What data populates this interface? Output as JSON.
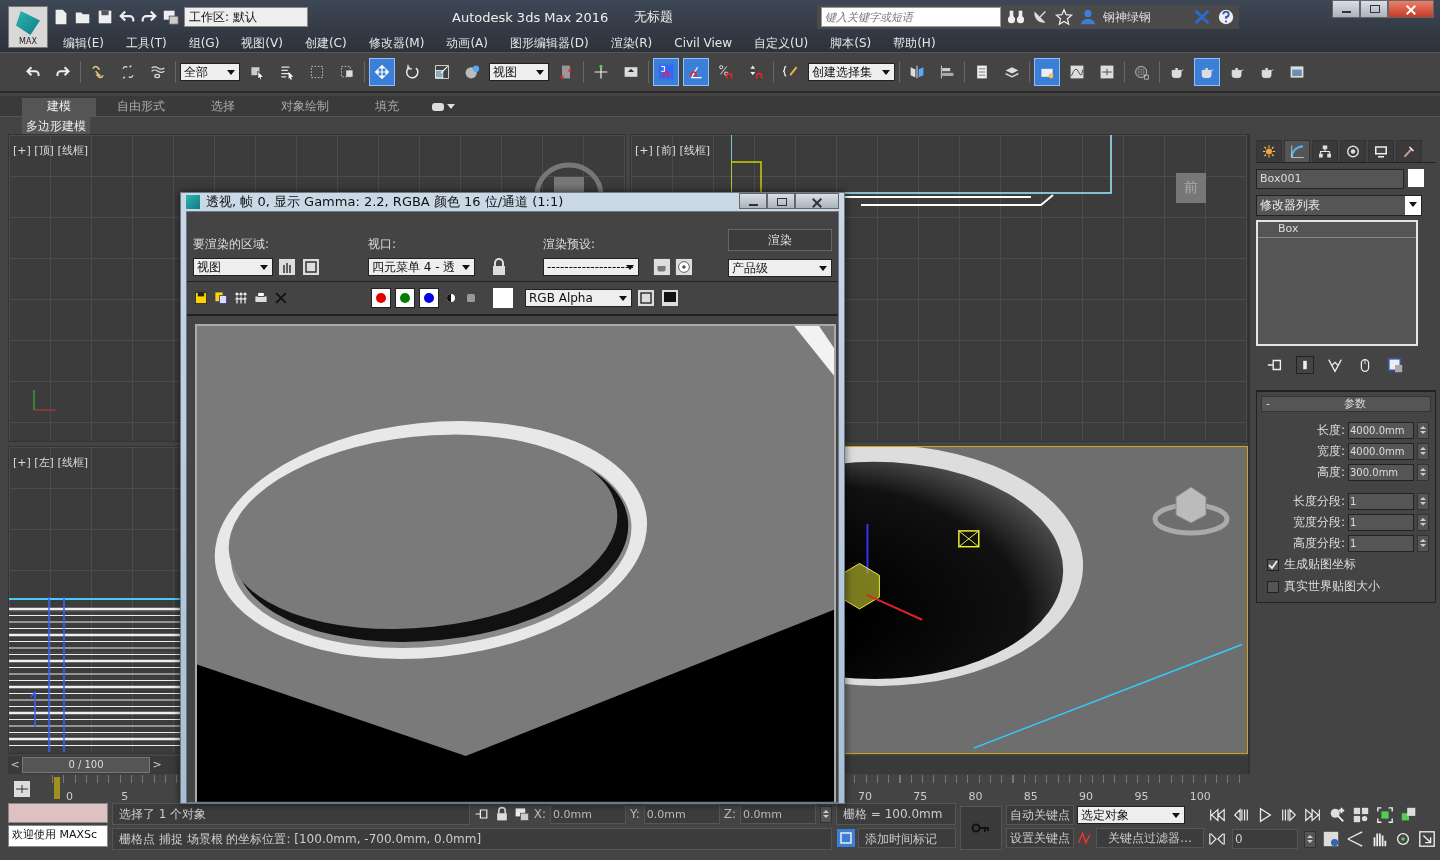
{
  "title_bar": {
    "logo": "MAX",
    "workspace": "工作区: 默认",
    "app_title": "Autodesk 3ds Max 2016",
    "document": "无标题",
    "search": {
      "placeholder": "键入关键字或短语"
    },
    "user": "钢神绿钢"
  },
  "menu": [
    "编辑(E)",
    "工具(T)",
    "组(G)",
    "视图(V)",
    "创建(C)",
    "修改器(M)",
    "动画(A)",
    "图形编辑器(D)",
    "渲染(R)",
    "Civil View",
    "自定义(U)",
    "脚本(S)",
    "帮助(H)"
  ],
  "toolbar": [
    {
      "kind": "undo",
      "selected": false
    },
    {
      "kind": "redo",
      "selected": false
    },
    {
      "kind": "sep"
    },
    {
      "kind": "link",
      "selected": false
    },
    {
      "kind": "unlink",
      "selected": false
    },
    {
      "kind": "wave",
      "selected": false
    },
    {
      "kind": "sep"
    },
    {
      "kind": "dropdown",
      "value": "全部"
    },
    {
      "kind": "select",
      "selected": false
    },
    {
      "kind": "select-list",
      "selected": false
    },
    {
      "kind": "rect-region",
      "selected": false
    },
    {
      "kind": "crossing",
      "selected": false
    },
    {
      "kind": "sep"
    },
    {
      "kind": "move",
      "selected": true
    },
    {
      "kind": "rotate",
      "selected": false
    },
    {
      "kind": "scale",
      "selected": false
    },
    {
      "kind": "sphere",
      "selected": false
    },
    {
      "kind": "dropdown",
      "value": "视图"
    },
    {
      "kind": "pivot",
      "selected": false
    },
    {
      "kind": "sep"
    },
    {
      "kind": "axis",
      "selected": false
    },
    {
      "kind": "tray",
      "selected": false
    },
    {
      "kind": "sep"
    },
    {
      "kind": "snap",
      "selected": true
    },
    {
      "kind": "angle-snap",
      "selected": true
    },
    {
      "kind": "percent-snap",
      "selected": false
    },
    {
      "kind": "spinner-snap",
      "selected": false
    },
    {
      "kind": "sep"
    },
    {
      "kind": "pencil",
      "selected": false
    },
    {
      "kind": "dropdown",
      "value": "创建选择集"
    },
    {
      "kind": "sep"
    },
    {
      "kind": "mirror",
      "selected": false
    },
    {
      "kind": "align",
      "selected": false
    },
    {
      "kind": "sep"
    },
    {
      "kind": "list",
      "selected": false
    },
    {
      "kind": "layers",
      "selected": false
    },
    {
      "kind": "sep"
    },
    {
      "kind": "folder",
      "selected": true
    },
    {
      "kind": "curve",
      "selected": false
    },
    {
      "kind": "schematic",
      "selected": false
    },
    {
      "kind": "sep"
    },
    {
      "kind": "checker-sphere",
      "selected": false
    },
    {
      "kind": "sep"
    },
    {
      "kind": "teapot",
      "selected": false
    },
    {
      "kind": "teapot",
      "selected": true
    },
    {
      "kind": "teapot",
      "selected": false
    },
    {
      "kind": "teapot",
      "selected": false
    },
    {
      "kind": "picture",
      "selected": false
    }
  ],
  "ribbon": {
    "tabs": [
      {
        "label": "建模",
        "selected": true
      },
      {
        "label": "自由形式",
        "selected": false
      },
      {
        "label": "选择",
        "selected": false
      },
      {
        "label": "对象绘制",
        "selected": false
      },
      {
        "label": "填充",
        "selected": false
      }
    ],
    "panel": "多边形建模"
  },
  "viewports": [
    {
      "kind": "top",
      "label": "[+] [顶] [线框]"
    },
    {
      "kind": "front",
      "label": "[+] [前] [线框]",
      "cube_label": "前"
    },
    {
      "kind": "left",
      "label": "[+] [左] [线框]"
    },
    {
      "kind": "perspective"
    }
  ],
  "time_slider": {
    "prev": "<",
    "position": "0 / 100",
    "next": ">"
  },
  "ruler": {
    "start_ticks": [
      "0",
      "5"
    ],
    "end_ticks": [
      "70",
      "75",
      "80",
      "85",
      "90",
      "95",
      "100"
    ]
  },
  "command_panel": {
    "tabs": [
      {
        "kind": "sun",
        "selected": false
      },
      {
        "kind": "arc",
        "selected": true
      },
      {
        "kind": "hierarchy",
        "selected": false
      },
      {
        "kind": "target",
        "selected": false
      },
      {
        "kind": "monitor",
        "selected": false
      },
      {
        "kind": "hammer",
        "selected": false
      }
    ],
    "object_name": "Box001",
    "modifier_list": "修改器列表",
    "stack": [
      "Box"
    ],
    "rollout": {
      "toggle": "-",
      "title": "参数"
    },
    "params": [
      {
        "label": "长度:",
        "value": "4000.0mm"
      },
      {
        "label": "宽度:",
        "value": "4000.0mm"
      },
      {
        "label": "高度:",
        "value": "300.0mm"
      }
    ],
    "segments": [
      {
        "label": "长度分段:",
        "value": "1"
      },
      {
        "label": "宽度分段:",
        "value": "1"
      },
      {
        "label": "高度分段:",
        "value": "1"
      }
    ],
    "options": [
      {
        "label": "生成贴图坐标",
        "checked": true
      },
      {
        "label": "真实世界贴图大小",
        "checked": false
      }
    ]
  },
  "render_window": {
    "title": "透视, 帧 0, 显示 Gamma: 2.2, RGBA 颜色 16 位/通道 (1:1)",
    "area_label": "要渲染的区域:",
    "area": "视图",
    "viewport_label": "视口:",
    "viewport": "四元菜单 4 - 透",
    "preset_label": "渲染预设:",
    "preset": "--------------------",
    "render_button": "渲染",
    "quality": "产品级",
    "channels": [
      {
        "color": "#e00000",
        "selected": true
      },
      {
        "color": "#008000",
        "selected": true
      },
      {
        "color": "#0000e0",
        "selected": true
      }
    ],
    "display": "RGB Alpha"
  },
  "status": {
    "maxscript": "欢迎使用 MAXSc",
    "selection": "选择了 1 个对象",
    "prompt": "栅格点 捕捉 场景根 的坐标位置:  [100.0mm, -700.0mm, 0.0mm]",
    "coords": [
      {
        "axis": "X:",
        "value": "0.0mm"
      },
      {
        "axis": "Y:",
        "value": "0.0mm"
      },
      {
        "axis": "Z:",
        "value": "0.0mm"
      }
    ],
    "grid": "栅格 = 100.0mm",
    "add_time_tag": "添加时间标记",
    "auto_key": "自动关键点",
    "set_key": "设置关键点",
    "key_mode": "选定对象",
    "key_filters": "关键点过滤器...",
    "frame": "0"
  }
}
